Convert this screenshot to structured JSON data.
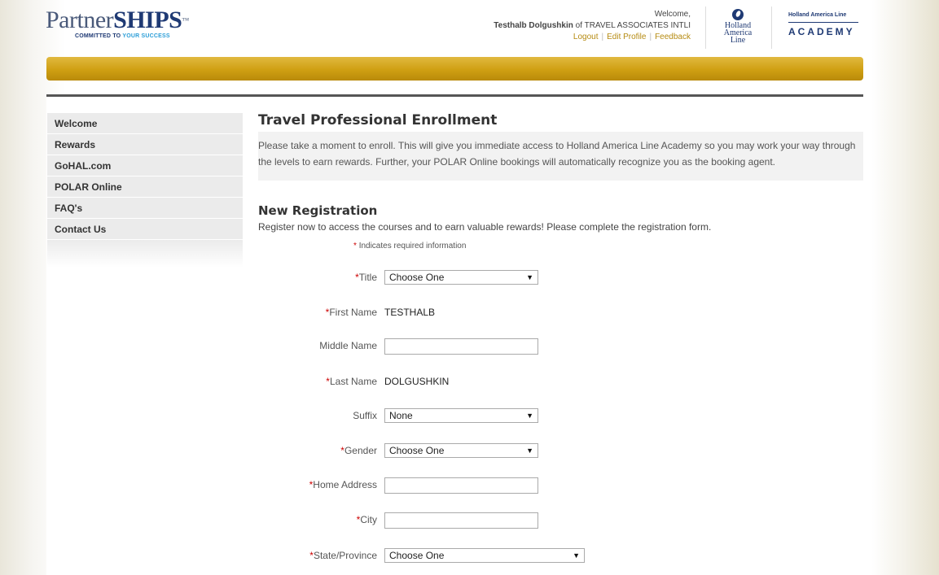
{
  "header": {
    "logo": {
      "main_prefix": "Partner",
      "main_ships": "SHIPS",
      "tm": "™",
      "tag_prefix": "COMMITTED TO ",
      "tag_highlight": "YOUR SUCCESS"
    },
    "welcome": "Welcome,",
    "user_name": "Testhalb Dolgushkin",
    "user_of": "of TRAVEL ASSOCIATES INTLI",
    "links": {
      "logout": "Logout",
      "edit_profile": "Edit Profile",
      "feedback": "Feedback",
      "separator": "|"
    },
    "hal_logo": {
      "line1": "Holland",
      "line2": "America Line"
    },
    "academy": {
      "line1": "Holland America Line",
      "line2": "ACADEMY"
    }
  },
  "colors": {
    "gold": "#cf9f12",
    "navy": "#1f3a74",
    "link_gold": "#b68b12",
    "required_star": "#cc0000"
  },
  "sidebar": {
    "items": [
      {
        "label": "Welcome"
      },
      {
        "label": "Rewards"
      },
      {
        "label": "GoHAL.com"
      },
      {
        "label": "POLAR Online"
      },
      {
        "label": "FAQ's"
      },
      {
        "label": "Contact Us"
      }
    ]
  },
  "main": {
    "title": "Travel Professional Enrollment",
    "intro": "Please take a moment to enroll. This will give you immediate access to Holland America Line Academy so you may work your way through the levels to earn rewards. Further, your POLAR Online bookings will automatically recognize you as the booking agent.",
    "reg_title": "New Registration",
    "reg_text": "Register now to access the courses and to earn valuable rewards! Please complete the registration form.",
    "required_mark": "*",
    "required_note": "Indicates required information"
  },
  "form": {
    "title": {
      "label": "Title",
      "value": "Choose One"
    },
    "first_name": {
      "label": "First Name",
      "value": "TESTHALB"
    },
    "middle_name": {
      "label": "Middle Name",
      "value": ""
    },
    "last_name": {
      "label": "Last Name",
      "value": "DOLGUSHKIN"
    },
    "suffix": {
      "label": "Suffix",
      "value": "None"
    },
    "gender": {
      "label": "Gender",
      "value": "Choose One"
    },
    "home_address": {
      "label": "Home Address",
      "value": ""
    },
    "city": {
      "label": "City",
      "value": ""
    },
    "state": {
      "label": "State/Province",
      "value": "Choose One"
    },
    "dropdown_arrow": "▼"
  }
}
